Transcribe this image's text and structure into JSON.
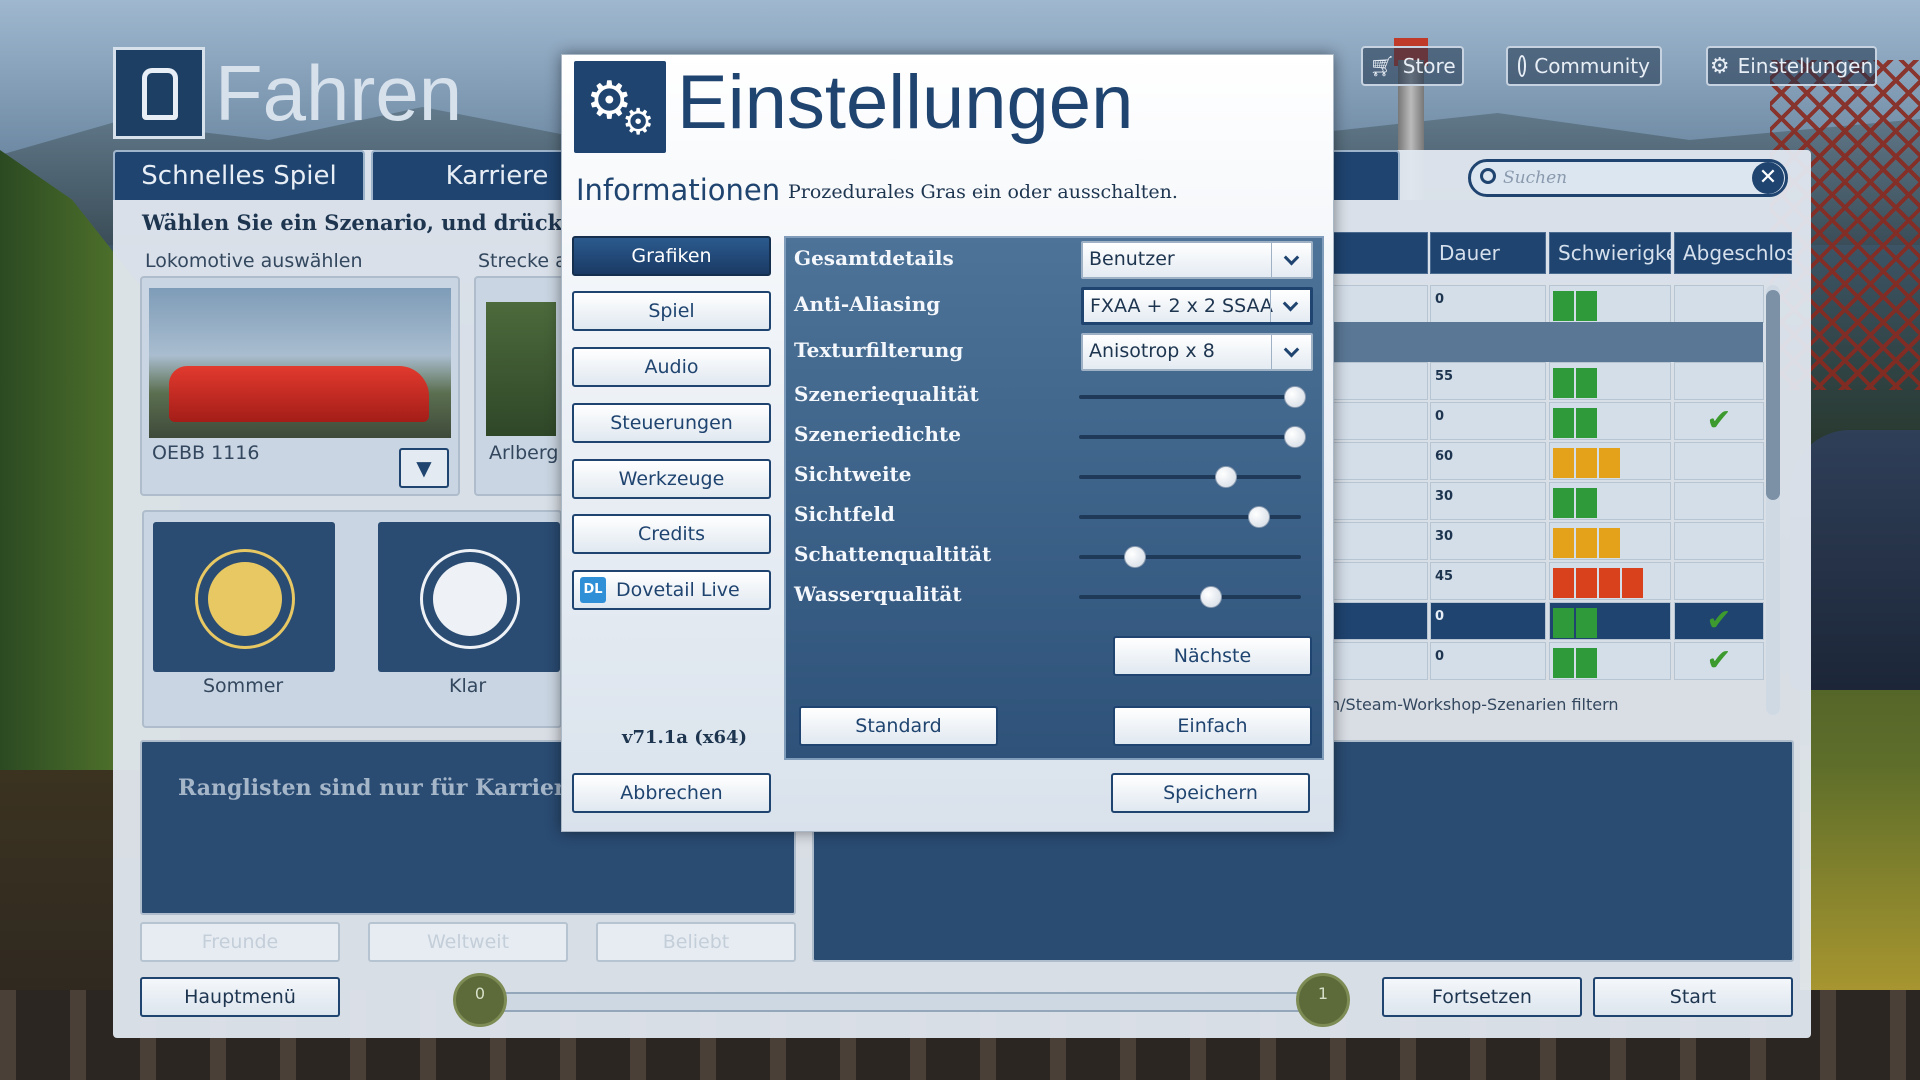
{
  "header": {
    "title": "Fahren",
    "store": "Store",
    "community": "Community",
    "settings": "Einstellungen"
  },
  "tabs": [
    "Schnelles Spiel",
    "Karriere"
  ],
  "search": {
    "placeholder": "Suchen"
  },
  "main": {
    "heading": "Wählen Sie ein Szenario, und drücken S",
    "loco_label": "Lokomotive auswählen",
    "route_label": "Strecke a",
    "loco_name": "OEBB 1116",
    "route_name": "Arlberg",
    "weather": [
      {
        "label": "Sommer"
      },
      {
        "label": "Klar"
      }
    ],
    "leaderboard_text": "Ranglisten sind nur für Karriere Sze",
    "leaderboard_buttons": [
      "Freunde",
      "Weltweit",
      "Beliebt"
    ],
    "main_menu": "Hauptmenü",
    "slider_min": "0",
    "slider_max": "1",
    "continue": "Fortsetzen",
    "start": "Start"
  },
  "table": {
    "headers": {
      "duration": "Dauer",
      "difficulty": "Schwierigke",
      "completed": "Abgeschlos"
    },
    "rows": [
      {
        "duration": "0",
        "difficulty": 2,
        "diff_color": "#2f9a3a",
        "completed": false
      },
      {
        "duration": "55",
        "difficulty": 2,
        "diff_color": "#2f9a3a",
        "completed": false
      },
      {
        "duration": "0",
        "difficulty": 2,
        "diff_color": "#2f9a3a",
        "completed": true
      },
      {
        "duration": "60",
        "difficulty": 3,
        "diff_color": "#e3a21a",
        "completed": false
      },
      {
        "duration": "30",
        "difficulty": 2,
        "diff_color": "#2f9a3a",
        "completed": false
      },
      {
        "duration": "30",
        "difficulty": 3,
        "diff_color": "#e3a21a",
        "completed": false
      },
      {
        "duration": "45",
        "difficulty": 4,
        "diff_color": "#d9411c",
        "completed": false
      },
      {
        "duration": "0",
        "difficulty": 2,
        "diff_color": "#2f9a3a",
        "completed": true
      },
      {
        "duration": "0",
        "difficulty": 2,
        "diff_color": "#2f9a3a",
        "completed": true
      }
    ],
    "workshop_filter": "n/Steam-Workshop-Szenarien filtern"
  },
  "dialog": {
    "title": "Einstellungen",
    "info_heading": "Informationen",
    "info_text": "Prozedurales Gras ein oder ausschalten.",
    "nav": [
      "Grafiken",
      "Spiel",
      "Audio",
      "Steuerungen",
      "Werkzeuge",
      "Credits"
    ],
    "dovetail": "Dovetail Live",
    "version": "v71.1a (x64)",
    "cancel": "Abbrechen",
    "save": "Speichern",
    "next": "Nächste",
    "standard": "Standard",
    "simple": "Einfach",
    "selects": [
      {
        "label": "Gesamtdetails",
        "value": "Benutzer"
      },
      {
        "label": "Anti-Aliasing",
        "value": "FXAA + 2 x 2 SSAA"
      },
      {
        "label": "Texturfilterung",
        "value": "Anisotrop x 8"
      }
    ],
    "sliders": [
      {
        "label": "Szeneriequalität",
        "level": 1.0
      },
      {
        "label": "Szeneriedichte",
        "level": 1.0
      },
      {
        "label": "Sichtweite",
        "level": 0.67
      },
      {
        "label": "Sichtfeld",
        "level": 0.83
      },
      {
        "label": "Schattenqualtität",
        "level": 0.24
      },
      {
        "label": "Wasserqualität",
        "level": 0.6
      }
    ]
  },
  "colors": {
    "accent": "#1f4470",
    "check": "#3d9a2f"
  }
}
